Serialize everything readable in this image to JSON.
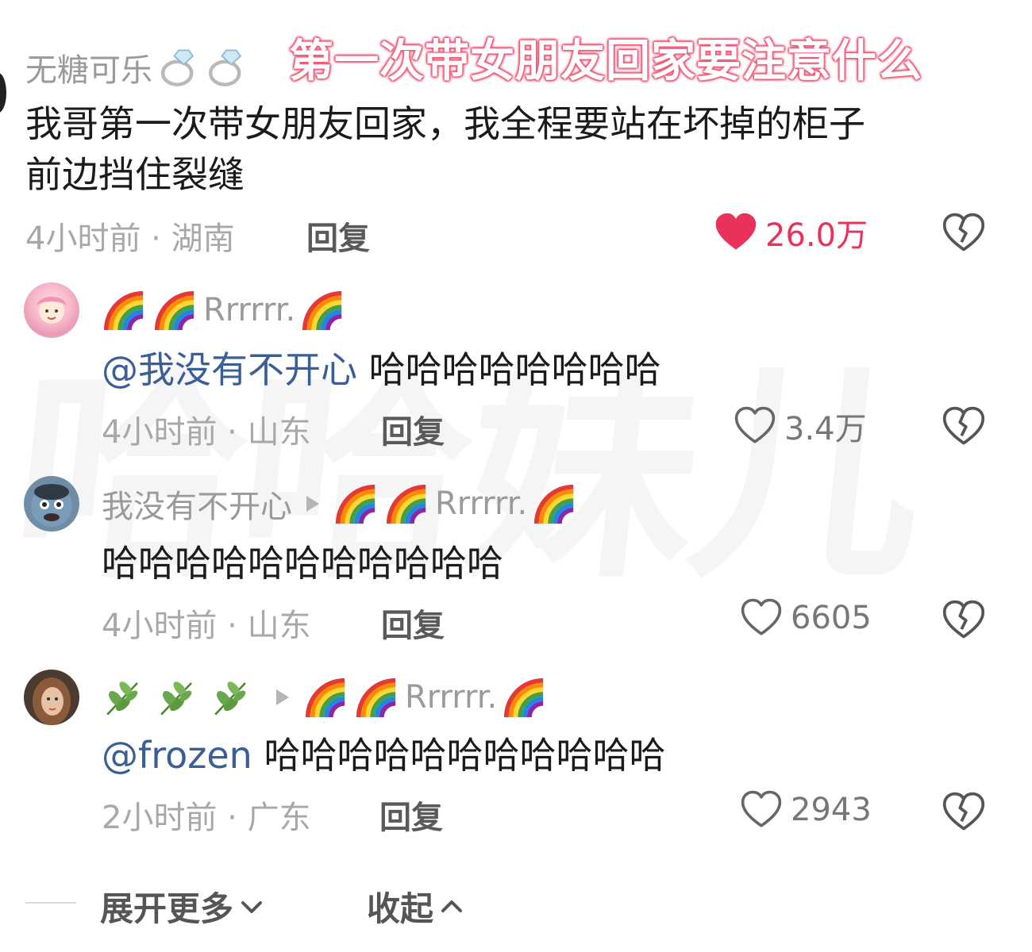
{
  "overlay_title": "第一次带女朋友回家要注意什么",
  "watermark": "哈哈妹儿",
  "comments": [
    {
      "username": "无糖可乐",
      "text_line1": "我哥第一次带女朋友回家，我全程要站在坏掉的柜子",
      "text_line2": "前边挡住裂缝",
      "time": "4小时前 · 湖南",
      "reply": "回复",
      "likes": "26.0万"
    },
    {
      "username": "Rrrrrr.",
      "mention": "@我没有不开心",
      "text": " 哈哈哈哈哈哈哈哈",
      "time": "4小时前 · 山东",
      "reply": "回复",
      "likes": "3.4万"
    },
    {
      "username": "我没有不开心",
      "target": "Rrrrrr.",
      "text": "哈哈哈哈哈哈哈哈哈哈哈",
      "time": "4小时前 · 山东",
      "reply": "回复",
      "likes": "6605"
    },
    {
      "target": "Rrrrrr.",
      "mention": "@frozen",
      "text": " 哈哈哈哈哈哈哈哈哈哈哈",
      "time": "2小时前 · 广东",
      "reply": "回复",
      "likes": "2943"
    }
  ],
  "footer": {
    "expand_more": "展开更多",
    "collapse": "收起"
  },
  "colors": {
    "liked": "#e8325b",
    "mention": "#3a5f96",
    "meta": "#a8a8a8"
  },
  "icons": [
    "heart-filled-icon",
    "heart-outline-icon",
    "broken-heart-icon",
    "rainbow-emoji",
    "ring-emoji",
    "herb-emoji",
    "reply-arrow-icon",
    "chevron-down-icon",
    "chevron-up-icon"
  ]
}
